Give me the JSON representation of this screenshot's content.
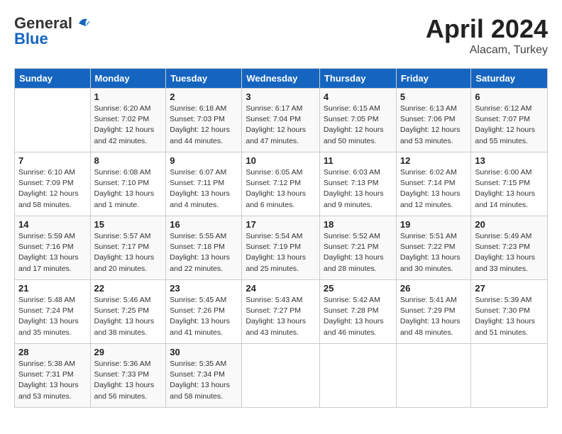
{
  "header": {
    "logo_general": "General",
    "logo_blue": "Blue",
    "month": "April 2024",
    "location": "Alacam, Turkey"
  },
  "days_of_week": [
    "Sunday",
    "Monday",
    "Tuesday",
    "Wednesday",
    "Thursday",
    "Friday",
    "Saturday"
  ],
  "weeks": [
    [
      {
        "day": "",
        "sunrise": "",
        "sunset": "",
        "daylight": ""
      },
      {
        "day": "1",
        "sunrise": "Sunrise: 6:20 AM",
        "sunset": "Sunset: 7:02 PM",
        "daylight": "Daylight: 12 hours and 42 minutes."
      },
      {
        "day": "2",
        "sunrise": "Sunrise: 6:18 AM",
        "sunset": "Sunset: 7:03 PM",
        "daylight": "Daylight: 12 hours and 44 minutes."
      },
      {
        "day": "3",
        "sunrise": "Sunrise: 6:17 AM",
        "sunset": "Sunset: 7:04 PM",
        "daylight": "Daylight: 12 hours and 47 minutes."
      },
      {
        "day": "4",
        "sunrise": "Sunrise: 6:15 AM",
        "sunset": "Sunset: 7:05 PM",
        "daylight": "Daylight: 12 hours and 50 minutes."
      },
      {
        "day": "5",
        "sunrise": "Sunrise: 6:13 AM",
        "sunset": "Sunset: 7:06 PM",
        "daylight": "Daylight: 12 hours and 53 minutes."
      },
      {
        "day": "6",
        "sunrise": "Sunrise: 6:12 AM",
        "sunset": "Sunset: 7:07 PM",
        "daylight": "Daylight: 12 hours and 55 minutes."
      }
    ],
    [
      {
        "day": "7",
        "sunrise": "Sunrise: 6:10 AM",
        "sunset": "Sunset: 7:09 PM",
        "daylight": "Daylight: 12 hours and 58 minutes."
      },
      {
        "day": "8",
        "sunrise": "Sunrise: 6:08 AM",
        "sunset": "Sunset: 7:10 PM",
        "daylight": "Daylight: 13 hours and 1 minute."
      },
      {
        "day": "9",
        "sunrise": "Sunrise: 6:07 AM",
        "sunset": "Sunset: 7:11 PM",
        "daylight": "Daylight: 13 hours and 4 minutes."
      },
      {
        "day": "10",
        "sunrise": "Sunrise: 6:05 AM",
        "sunset": "Sunset: 7:12 PM",
        "daylight": "Daylight: 13 hours and 6 minutes."
      },
      {
        "day": "11",
        "sunrise": "Sunrise: 6:03 AM",
        "sunset": "Sunset: 7:13 PM",
        "daylight": "Daylight: 13 hours and 9 minutes."
      },
      {
        "day": "12",
        "sunrise": "Sunrise: 6:02 AM",
        "sunset": "Sunset: 7:14 PM",
        "daylight": "Daylight: 13 hours and 12 minutes."
      },
      {
        "day": "13",
        "sunrise": "Sunrise: 6:00 AM",
        "sunset": "Sunset: 7:15 PM",
        "daylight": "Daylight: 13 hours and 14 minutes."
      }
    ],
    [
      {
        "day": "14",
        "sunrise": "Sunrise: 5:59 AM",
        "sunset": "Sunset: 7:16 PM",
        "daylight": "Daylight: 13 hours and 17 minutes."
      },
      {
        "day": "15",
        "sunrise": "Sunrise: 5:57 AM",
        "sunset": "Sunset: 7:17 PM",
        "daylight": "Daylight: 13 hours and 20 minutes."
      },
      {
        "day": "16",
        "sunrise": "Sunrise: 5:55 AM",
        "sunset": "Sunset: 7:18 PM",
        "daylight": "Daylight: 13 hours and 22 minutes."
      },
      {
        "day": "17",
        "sunrise": "Sunrise: 5:54 AM",
        "sunset": "Sunset: 7:19 PM",
        "daylight": "Daylight: 13 hours and 25 minutes."
      },
      {
        "day": "18",
        "sunrise": "Sunrise: 5:52 AM",
        "sunset": "Sunset: 7:21 PM",
        "daylight": "Daylight: 13 hours and 28 minutes."
      },
      {
        "day": "19",
        "sunrise": "Sunrise: 5:51 AM",
        "sunset": "Sunset: 7:22 PM",
        "daylight": "Daylight: 13 hours and 30 minutes."
      },
      {
        "day": "20",
        "sunrise": "Sunrise: 5:49 AM",
        "sunset": "Sunset: 7:23 PM",
        "daylight": "Daylight: 13 hours and 33 minutes."
      }
    ],
    [
      {
        "day": "21",
        "sunrise": "Sunrise: 5:48 AM",
        "sunset": "Sunset: 7:24 PM",
        "daylight": "Daylight: 13 hours and 35 minutes."
      },
      {
        "day": "22",
        "sunrise": "Sunrise: 5:46 AM",
        "sunset": "Sunset: 7:25 PM",
        "daylight": "Daylight: 13 hours and 38 minutes."
      },
      {
        "day": "23",
        "sunrise": "Sunrise: 5:45 AM",
        "sunset": "Sunset: 7:26 PM",
        "daylight": "Daylight: 13 hours and 41 minutes."
      },
      {
        "day": "24",
        "sunrise": "Sunrise: 5:43 AM",
        "sunset": "Sunset: 7:27 PM",
        "daylight": "Daylight: 13 hours and 43 minutes."
      },
      {
        "day": "25",
        "sunrise": "Sunrise: 5:42 AM",
        "sunset": "Sunset: 7:28 PM",
        "daylight": "Daylight: 13 hours and 46 minutes."
      },
      {
        "day": "26",
        "sunrise": "Sunrise: 5:41 AM",
        "sunset": "Sunset: 7:29 PM",
        "daylight": "Daylight: 13 hours and 48 minutes."
      },
      {
        "day": "27",
        "sunrise": "Sunrise: 5:39 AM",
        "sunset": "Sunset: 7:30 PM",
        "daylight": "Daylight: 13 hours and 51 minutes."
      }
    ],
    [
      {
        "day": "28",
        "sunrise": "Sunrise: 5:38 AM",
        "sunset": "Sunset: 7:31 PM",
        "daylight": "Daylight: 13 hours and 53 minutes."
      },
      {
        "day": "29",
        "sunrise": "Sunrise: 5:36 AM",
        "sunset": "Sunset: 7:33 PM",
        "daylight": "Daylight: 13 hours and 56 minutes."
      },
      {
        "day": "30",
        "sunrise": "Sunrise: 5:35 AM",
        "sunset": "Sunset: 7:34 PM",
        "daylight": "Daylight: 13 hours and 58 minutes."
      },
      {
        "day": "",
        "sunrise": "",
        "sunset": "",
        "daylight": ""
      },
      {
        "day": "",
        "sunrise": "",
        "sunset": "",
        "daylight": ""
      },
      {
        "day": "",
        "sunrise": "",
        "sunset": "",
        "daylight": ""
      },
      {
        "day": "",
        "sunrise": "",
        "sunset": "",
        "daylight": ""
      }
    ]
  ]
}
